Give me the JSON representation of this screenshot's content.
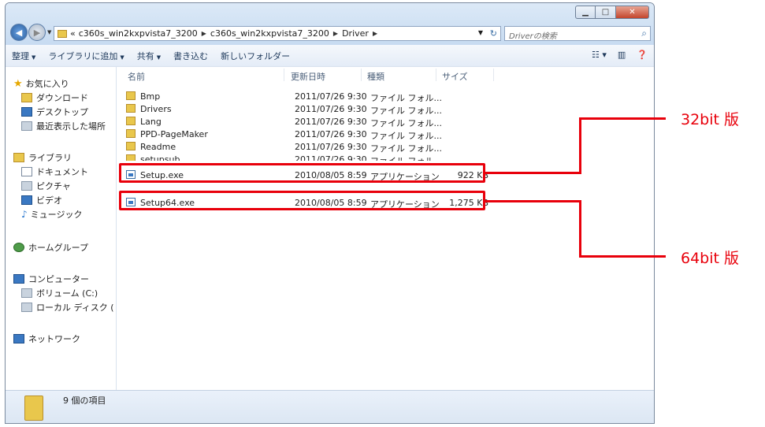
{
  "address": {
    "chevron": "«",
    "segments": [
      "c360s_win2kxpvista7_3200",
      "c360s_win2kxpvista7_3200",
      "Driver"
    ],
    "search_placeholder": "Driverの検索"
  },
  "toolbar": {
    "organize": "整理",
    "add_to_library": "ライブラリに追加",
    "share": "共有",
    "burn": "書き込む",
    "new_folder": "新しいフォルダー"
  },
  "sidebar": {
    "favorites": "お気に入り",
    "downloads": "ダウンロード",
    "desktop": "デスクトップ",
    "recent": "最近表示した場所",
    "libraries": "ライブラリ",
    "documents": "ドキュメント",
    "pictures": "ピクチャ",
    "videos": "ビデオ",
    "music": "ミュージック",
    "homegroup": "ホームグループ",
    "computer": "コンピューター",
    "volume_c": "ボリューム (C:)",
    "local_disk": "ローカル ディスク (",
    "network": "ネットワーク"
  },
  "columns": {
    "name": "名前",
    "modified": "更新日時",
    "type": "種類",
    "size": "サイズ"
  },
  "files": [
    {
      "name": "Bmp",
      "date": "2011/07/26 9:30",
      "type": "ファイル フォル...",
      "size": ""
    },
    {
      "name": "Drivers",
      "date": "2011/07/26 9:30",
      "type": "ファイル フォル...",
      "size": ""
    },
    {
      "name": "Lang",
      "date": "2011/07/26 9:30",
      "type": "ファイル フォル...",
      "size": ""
    },
    {
      "name": "PPD-PageMaker",
      "date": "2011/07/26 9:30",
      "type": "ファイル フォル...",
      "size": ""
    },
    {
      "name": "Readme",
      "date": "2011/07/26 9:30",
      "type": "ファイル フォル...",
      "size": ""
    },
    {
      "name": "setupsub",
      "date": "2011/07/26 9:30",
      "type": "ファイル フォル...",
      "size": ""
    },
    {
      "name": "Setup.exe",
      "date": "2010/08/05 8:59",
      "type": "アプリケーション",
      "size": "922 KB"
    },
    {
      "name": "Setup64.exe",
      "date": "2010/08/05 8:59",
      "type": "アプリケーション",
      "size": "1,275 KB"
    }
  ],
  "status": {
    "item_count": "9 個の項目"
  },
  "callouts": {
    "bit32": "32bit 版",
    "bit64": "64bit 版"
  }
}
